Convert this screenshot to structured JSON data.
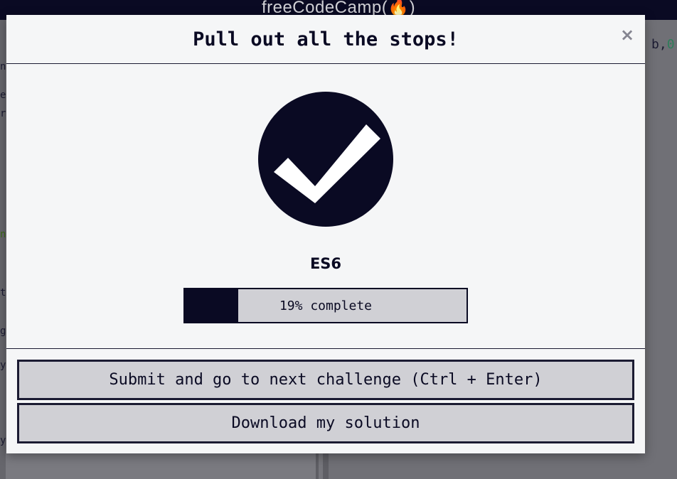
{
  "background": {
    "logo_text": "freeCodeCamp(🔥)",
    "code_token": "b",
    "code_sep": ",",
    "code_num": "0",
    "left_fragments": [
      "n",
      "e",
      "r",
      "n",
      "t",
      "g",
      "y",
      "y"
    ]
  },
  "modal": {
    "title": "Pull out all the stops!",
    "close_label": "×",
    "challenge_block": "ES6",
    "progress": {
      "percent": 19,
      "label": "19% complete"
    },
    "buttons": {
      "submit_label": "Submit and go to next challenge (Ctrl + Enter)",
      "download_label": "Download my solution"
    },
    "icons": {
      "success": "check-circle-icon",
      "close": "close-icon"
    },
    "colors": {
      "primary": "#0a0a23",
      "button_bg": "#d0d0d5",
      "modal_bg": "#f5f6f7"
    }
  }
}
